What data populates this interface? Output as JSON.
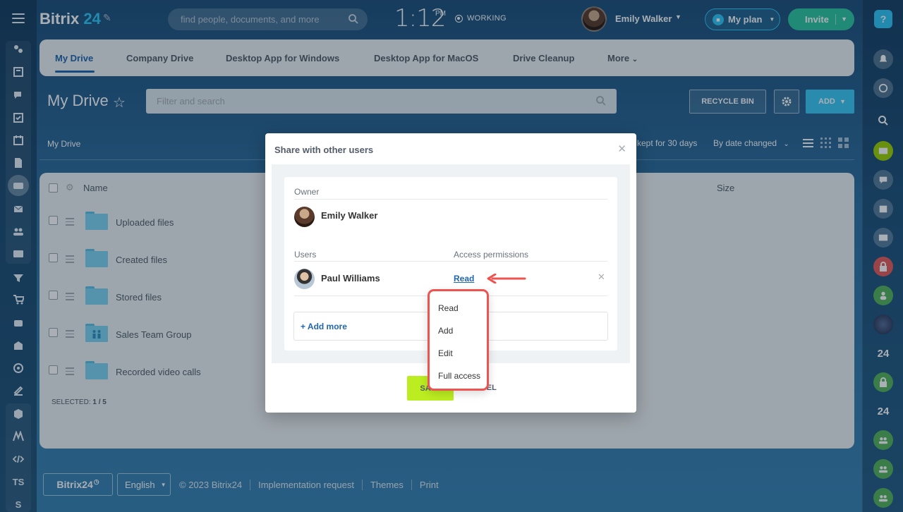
{
  "app": {
    "brand": "Bitrix",
    "brand_num": "24"
  },
  "header": {
    "search_placeholder": "find people, documents, and more",
    "clock": "1:12",
    "clock_suffix": "PM",
    "status": "WORKING",
    "user_name": "Emily Walker",
    "plan_label": "My plan",
    "invite_label": "Invite"
  },
  "tabs": [
    "My Drive",
    "Company Drive",
    "Desktop App for Windows",
    "Desktop App for MacOS",
    "Drive Cleanup",
    "More"
  ],
  "page": {
    "title": "My Drive",
    "filter_placeholder": "Filter and search",
    "recycle_bin": "RECYCLE BIN",
    "add": "ADD",
    "breadcrumb": "My Drive",
    "kept_text": "kept for 30 days",
    "sort": "By date changed"
  },
  "grid": {
    "col_name": "Name",
    "col_size": "Size",
    "rows": [
      {
        "name": "Uploaded files"
      },
      {
        "name": "Created files"
      },
      {
        "name": "Stored files"
      },
      {
        "name": "Sales Team Group"
      },
      {
        "name": "Recorded video calls"
      }
    ],
    "selected_label": "SELECTED:",
    "selected_value": "1 / 5"
  },
  "footer": {
    "logo": "Bitrix24",
    "lang": "English",
    "copyright": "© 2023 Bitrix24",
    "links": [
      "Implementation request",
      "Themes",
      "Print"
    ]
  },
  "right_badges": [
    "24",
    "24"
  ],
  "left_text": [
    "TS",
    "S"
  ],
  "modal": {
    "title": "Share with other users",
    "owner_label": "Owner",
    "owner_name": "Emily Walker",
    "users_label": "Users",
    "permissions_label": "Access permissions",
    "user_name": "Paul Williams",
    "permission": "Read",
    "add_more": "+ Add more",
    "save": "SAVE",
    "cancel": "CANCEL"
  },
  "permission_options": [
    "Read",
    "Add",
    "Edit",
    "Full access"
  ],
  "colors": {
    "accent": "#2066b0",
    "highlight": "#ef5350",
    "save": "#bbed21",
    "add_button": "#3bc8f5",
    "invite": "#2fc6a0"
  }
}
